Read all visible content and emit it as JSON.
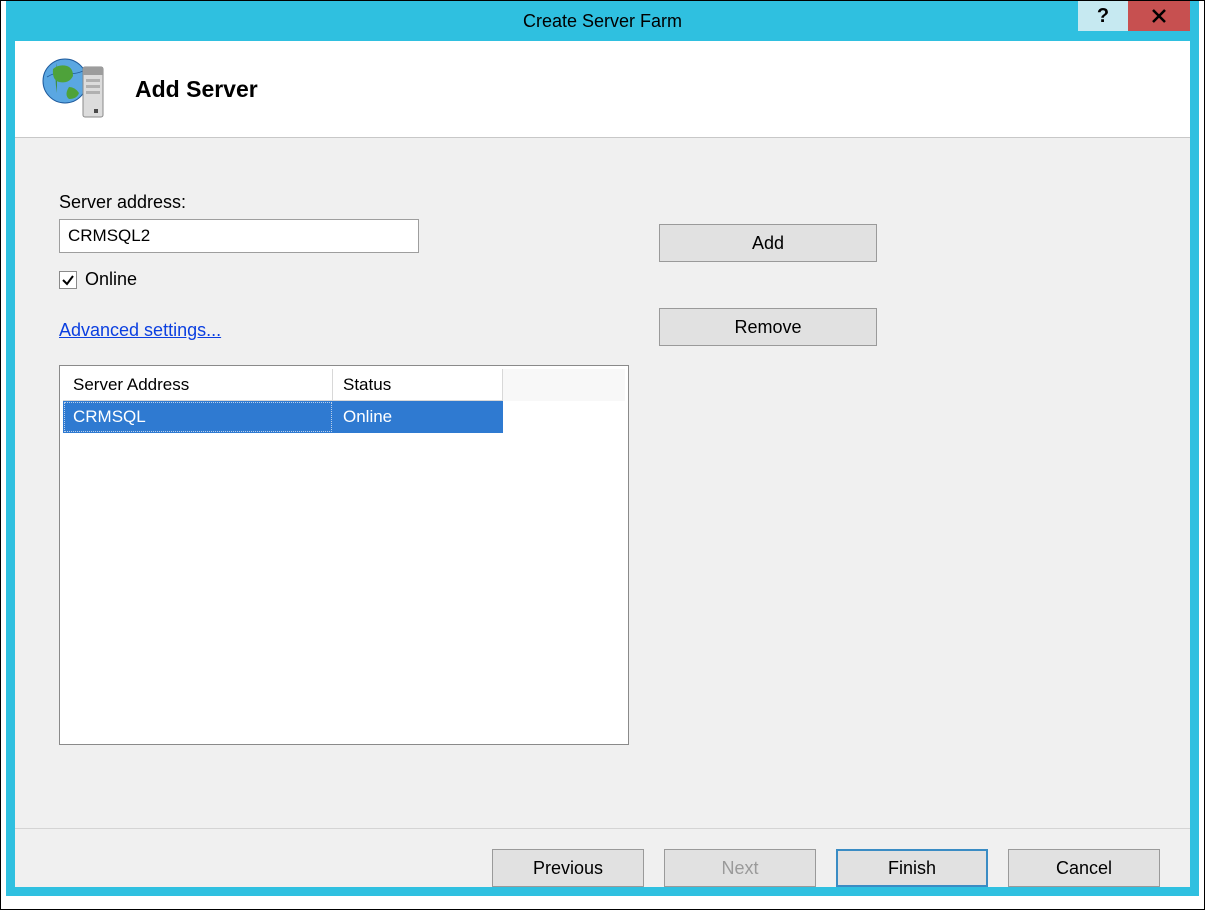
{
  "window": {
    "title": "Create Server Farm"
  },
  "header": {
    "title": "Add Server"
  },
  "form": {
    "server_address_label": "Server address:",
    "server_address_value": "CRMSQL2",
    "online_checkbox_label": "Online",
    "online_checked": true,
    "advanced_link": "Advanced settings..."
  },
  "buttons": {
    "add": "Add",
    "remove": "Remove",
    "previous": "Previous",
    "next": "Next",
    "finish": "Finish",
    "cancel": "Cancel"
  },
  "list": {
    "columns": {
      "address": "Server Address",
      "status": "Status"
    },
    "rows": [
      {
        "address": "CRMSQL",
        "status": "Online",
        "selected": true
      }
    ]
  }
}
